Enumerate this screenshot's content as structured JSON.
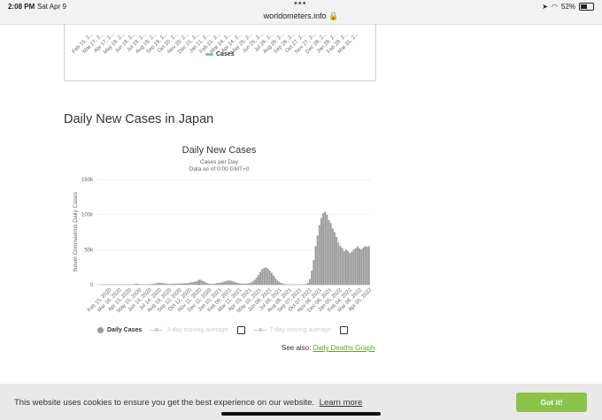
{
  "status_bar": {
    "time": "2:08 PM",
    "date": "Sat Apr 9",
    "url": "worldometers.info",
    "battery": "52%",
    "battery_level": 0.52
  },
  "prev_chart": {
    "legend": "Cases",
    "x_ticks": [
      "Feb 15, 2...",
      "Mar 17, 2...",
      "Apr 17, 2...",
      "May 18, 2...",
      "Jun 18, 2...",
      "Jul 19, 2...",
      "Aug 19, 2...",
      "Sep 19, 2...",
      "Oct 20, 2...",
      "Nov 20, 2...",
      "Dec 21, 2...",
      "Jan 21, 2...",
      "Feb 21, 2...",
      "Mar 24, 2...",
      "Apr 24, 2...",
      "May 25, 2...",
      "Jun 25, 2...",
      "Jul 26, 2...",
      "Aug 26, 2...",
      "Sep 26, 2...",
      "Oct 27, 2...",
      "Nov 27, 2...",
      "Dec 28, 2...",
      "Jan 28, 2...",
      "Feb 28, 2...",
      "Mar 31, 2..."
    ]
  },
  "section_title": "Daily New Cases in Japan",
  "chart_data": {
    "type": "bar",
    "title": "Daily New Cases",
    "subtitle": "Cases per Day",
    "subtitle2": "Data as of 0:00 GMT+0",
    "ylabel": "Novel Coronavirus Daily Cases",
    "ylim": [
      0,
      150000
    ],
    "y_ticks": [
      0,
      50000,
      100000,
      150000
    ],
    "y_tick_labels": [
      "0",
      "50k",
      "100k",
      "150k"
    ],
    "x_labels": [
      "Feb 15, 2020",
      "Mar 16, 2020",
      "Apr 15, 2020",
      "May 15, 2020",
      "Jun 14, 2020",
      "Jul 14, 2020",
      "Aug 13, 2020",
      "Sep 12, 2020",
      "Oct 12, 2020",
      "Nov 11, 2020",
      "Dec 11, 2020",
      "Jan 10, 2021",
      "Feb 09, 2021",
      "Mar 11, 2021",
      "Apr 10, 2021",
      "May 10, 2021",
      "Jun 09, 2021",
      "Jul 09, 2021",
      "Aug 08, 2021",
      "Sep 07, 2021",
      "Oct 07, 2021",
      "Nov 06, 2021",
      "Dec 06, 2021",
      "Jan 05, 2022",
      "Feb 04, 2022",
      "Mar 06, 2022",
      "Apr 05, 2022"
    ],
    "series": [
      {
        "name": "Daily Cases",
        "color": "#999999",
        "values": [
          0,
          0,
          0,
          10,
          10,
          50,
          200,
          400,
          600,
          700,
          400,
          200,
          100,
          100,
          100,
          100,
          100,
          200,
          400,
          1000,
          1500,
          1000,
          800,
          700,
          600,
          600,
          700,
          800,
          900,
          1200,
          1800,
          2500,
          3000,
          2500,
          2000,
          1800,
          1500,
          1200,
          1200,
          1300,
          1500,
          1600,
          1700,
          1800,
          1800,
          2000,
          2200,
          2500,
          3000,
          3500,
          4000,
          4500,
          5500,
          7000,
          7000,
          5500,
          4000,
          2500,
          1500,
          1200,
          1200,
          1500,
          2000,
          2500,
          3000,
          3500,
          4500,
          5500,
          6000,
          6000,
          5500,
          4500,
          3500,
          2500,
          2000,
          1700,
          1600,
          1600,
          1800,
          2200,
          3000,
          4500,
          7000,
          10000,
          14000,
          18000,
          22000,
          24000,
          25000,
          23000,
          20000,
          17000,
          13000,
          9000,
          6000,
          4000,
          2500,
          1500,
          800,
          400,
          200,
          150,
          150,
          150,
          150,
          150,
          200,
          300,
          500,
          1000,
          3000,
          8000,
          20000,
          35000,
          55000,
          70000,
          85000,
          95000,
          102000,
          104000,
          100000,
          92000,
          88000,
          80000,
          75000,
          68000,
          60000,
          55000,
          52000,
          48000,
          50000,
          48000,
          45000,
          47000,
          50000,
          52000,
          55000,
          52000,
          50000,
          53000,
          55000,
          54000,
          55000
        ]
      }
    ]
  },
  "legend": {
    "daily": "Daily Cases",
    "ma3": "3-day moving average",
    "ma7": "7-day moving average"
  },
  "see_also": {
    "label": "See also:",
    "link": "Daily Deaths Graph"
  },
  "cookie": {
    "message": "This website uses cookies to ensure you get the best experience on our website.",
    "learn_more": "Learn more",
    "button": "Got it!"
  },
  "colors": {
    "accent": "#8bc34a",
    "bars": "#999999",
    "prev_series": "#7cb5ec",
    "link": "#6a9e2f"
  }
}
